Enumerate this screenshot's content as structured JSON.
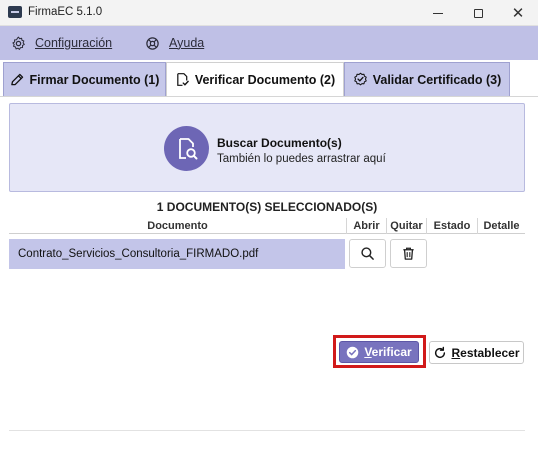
{
  "window": {
    "title": "FirmaEC 5.1.0",
    "minimize_icon": "minimize-icon",
    "maximize_icon": "maximize-icon",
    "close_icon": "close-icon",
    "close_glyph": "✕"
  },
  "menu": {
    "items": [
      {
        "label": "Configuración",
        "icon": "gear-icon"
      },
      {
        "label": "Ayuda",
        "icon": "help-icon"
      }
    ]
  },
  "tabs": [
    {
      "label": "Firmar Documento (1)",
      "icon": "sign-pen-icon",
      "active": false
    },
    {
      "label": "Verificar Documento (2)",
      "icon": "verify-document-icon",
      "active": true
    },
    {
      "label": "Validar Certificado (3)",
      "icon": "certificate-check-icon",
      "active": false
    }
  ],
  "dropzone": {
    "title": "Buscar Documento(s)",
    "subtitle": "También lo puedes arrastrar aquí",
    "icon": "search-document-icon"
  },
  "documents": {
    "count_label": "1 DOCUMENTO(S) SELECCIONADO(S)",
    "columns": [
      "Documento",
      "Abrir",
      "Quitar",
      "Estado",
      "Detalle"
    ],
    "rows": [
      {
        "name": "Contrato_Servicios_Consultoria_FIRMADO.pdf",
        "open_icon": "search-icon",
        "remove_icon": "trash-icon"
      }
    ]
  },
  "actions": {
    "verify": {
      "label_rest": "erificar",
      "label_underlined": "V",
      "icon": "check-circle-icon"
    },
    "reset": {
      "label_rest": "establecer",
      "label_underlined": "R",
      "icon": "refresh-icon"
    }
  },
  "colors": {
    "menu_bg": "#bfc0e6",
    "tab_inactive": "#c6c8ea",
    "accent": "#6d66b5",
    "selected_row": "#c3c5e9",
    "highlight": "#d11a1a"
  }
}
